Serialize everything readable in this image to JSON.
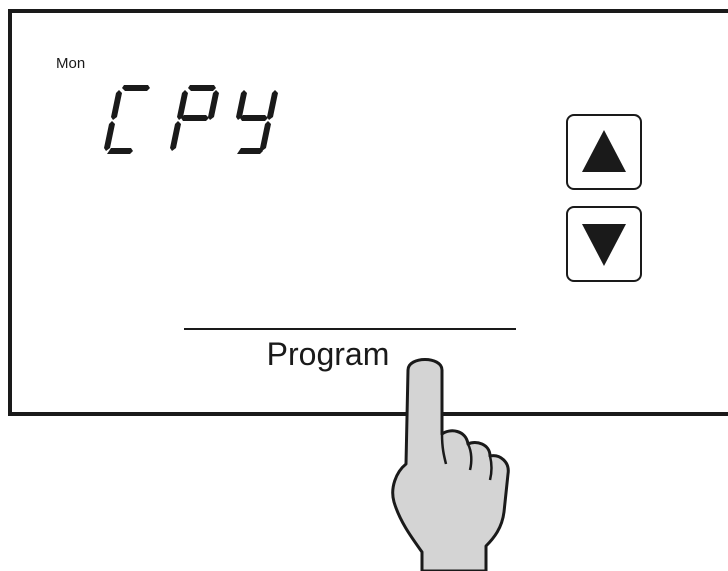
{
  "display": {
    "day": "Mon",
    "code": "CPY"
  },
  "buttons": {
    "up_icon": "triangle-up-icon",
    "down_icon": "triangle-down-icon",
    "program_label": "Program"
  },
  "illustration": {
    "hand_icon": "pointing-hand-icon",
    "hand_fill": "#d4d4d4",
    "ink_color": "#1a1a1a"
  }
}
